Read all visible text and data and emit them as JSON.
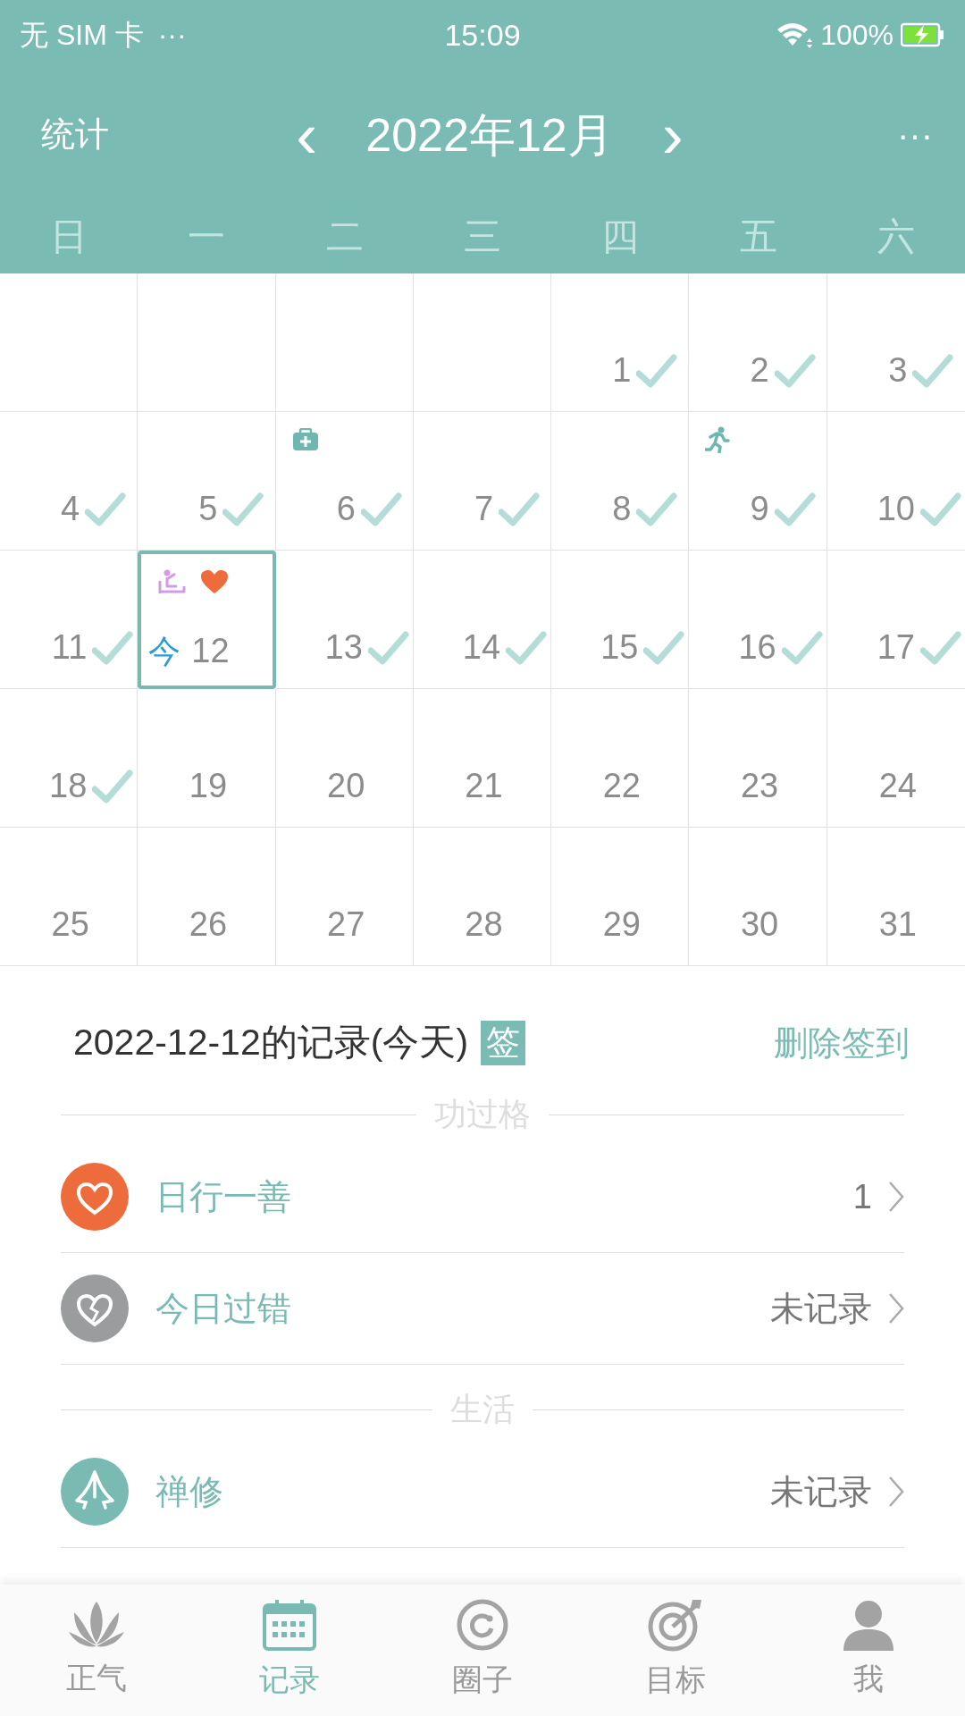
{
  "status_bar": {
    "carrier": "无 SIM 卡",
    "more": "···",
    "time": "15:09",
    "battery": "100%"
  },
  "header": {
    "left": "统计",
    "prev": "‹",
    "title": "2022年12月",
    "next": "›",
    "menu": "···"
  },
  "weekdays": [
    "日",
    "一",
    "二",
    "三",
    "四",
    "五",
    "六"
  ],
  "days": [
    {
      "kind": "empty"
    },
    {
      "kind": "empty"
    },
    {
      "kind": "empty"
    },
    {
      "kind": "empty"
    },
    {
      "kind": "day",
      "day": "1",
      "checked": true,
      "today": false
    },
    {
      "kind": "day",
      "day": "2",
      "checked": true,
      "today": false
    },
    {
      "kind": "day",
      "day": "3",
      "checked": true,
      "today": false
    },
    {
      "kind": "day",
      "day": "4",
      "checked": true,
      "today": false
    },
    {
      "kind": "day",
      "day": "5",
      "checked": true,
      "today": false
    },
    {
      "kind": "day",
      "day": "6",
      "checked": true,
      "today": false,
      "markers": [
        {
          "kind": "medical",
          "color": "#6fb7ae"
        }
      ]
    },
    {
      "kind": "day",
      "day": "7",
      "checked": true,
      "today": false
    },
    {
      "kind": "day",
      "day": "8",
      "checked": true,
      "today": false
    },
    {
      "kind": "day",
      "day": "9",
      "checked": true,
      "today": false,
      "markers": [
        {
          "kind": "running",
          "color": "#6fb7ae"
        }
      ]
    },
    {
      "kind": "day",
      "day": "10",
      "checked": true,
      "today": false
    },
    {
      "kind": "day",
      "day": "11",
      "checked": true,
      "today": false
    },
    {
      "kind": "day",
      "day": "12",
      "checked": false,
      "today": true,
      "today_label": "今",
      "markers": [
        {
          "kind": "meditation",
          "color": "#d39be6"
        },
        {
          "kind": "heart",
          "color": "#ee6b3b"
        }
      ]
    },
    {
      "kind": "day",
      "day": "13",
      "checked": true,
      "today": false
    },
    {
      "kind": "day",
      "day": "14",
      "checked": true,
      "today": false
    },
    {
      "kind": "day",
      "day": "15",
      "checked": true,
      "today": false
    },
    {
      "kind": "day",
      "day": "16",
      "checked": true,
      "today": false
    },
    {
      "kind": "day",
      "day": "17",
      "checked": true,
      "today": false
    },
    {
      "kind": "day",
      "day": "18",
      "checked": true,
      "today": false
    },
    {
      "kind": "day",
      "day": "19",
      "checked": false,
      "today": false
    },
    {
      "kind": "day",
      "day": "20",
      "checked": false,
      "today": false
    },
    {
      "kind": "day",
      "day": "21",
      "checked": false,
      "today": false
    },
    {
      "kind": "day",
      "day": "22",
      "checked": false,
      "today": false
    },
    {
      "kind": "day",
      "day": "23",
      "checked": false,
      "today": false
    },
    {
      "kind": "day",
      "day": "24",
      "checked": false,
      "today": false
    },
    {
      "kind": "day",
      "day": "25",
      "checked": false,
      "today": false
    },
    {
      "kind": "day",
      "day": "26",
      "checked": false,
      "today": false
    },
    {
      "kind": "day",
      "day": "27",
      "checked": false,
      "today": false
    },
    {
      "kind": "day",
      "day": "28",
      "checked": false,
      "today": false
    },
    {
      "kind": "day",
      "day": "29",
      "checked": false,
      "today": false
    },
    {
      "kind": "day",
      "day": "30",
      "checked": false,
      "today": false
    },
    {
      "kind": "day",
      "day": "31",
      "checked": false,
      "today": false
    }
  ],
  "record": {
    "title": "2022-12-12的记录(今天)",
    "sign_badge": "签",
    "delete": "删除签到"
  },
  "sections": [
    {
      "title": "功过格",
      "items": [
        {
          "kind": "heart",
          "color": "#ee6b3b",
          "label": "日行一善",
          "value": "1"
        },
        {
          "kind": "broken-heart",
          "color": "#9a9c9e",
          "label": "今日过错",
          "value": "未记录"
        }
      ]
    },
    {
      "title": "生活",
      "items": [
        {
          "kind": "meditation",
          "color": "#79bab3",
          "label": "禅修",
          "value": "未记录"
        }
      ]
    }
  ],
  "tabs": [
    {
      "kind": "lotus",
      "label": "正气",
      "selected": false
    },
    {
      "kind": "calendar",
      "label": "记录",
      "selected": true
    },
    {
      "kind": "circle",
      "label": "圈子",
      "selected": false
    },
    {
      "kind": "target",
      "label": "目标",
      "selected": false
    },
    {
      "kind": "person",
      "label": "我",
      "selected": false
    }
  ]
}
